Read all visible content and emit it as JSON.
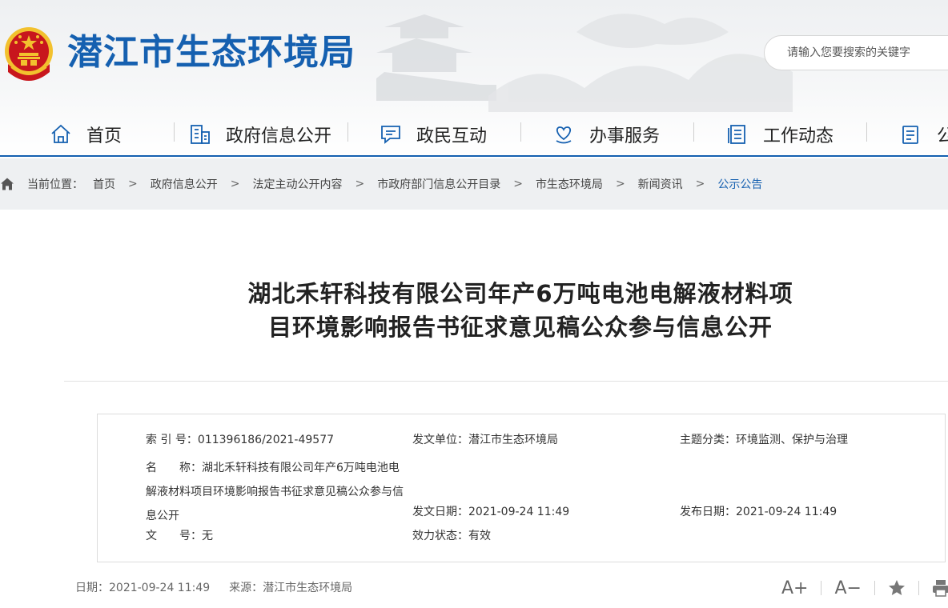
{
  "site": {
    "title": "潜江市生态环境局"
  },
  "search": {
    "placeholder": "请输入您要搜索的关键字"
  },
  "nav": {
    "items": [
      {
        "label": "首页",
        "icon": "home-icon"
      },
      {
        "label": "政府信息公开",
        "icon": "building-icon"
      },
      {
        "label": "政民互动",
        "icon": "chat-icon"
      },
      {
        "label": "办事服务",
        "icon": "heart-hand-icon"
      },
      {
        "label": "工作动态",
        "icon": "document-list-icon"
      },
      {
        "label": "公",
        "icon": "clipboard-icon"
      }
    ]
  },
  "breadcrumb": {
    "prefix": "当前位置：",
    "items": [
      "首页",
      "政府信息公开",
      "法定主动公开内容",
      "市政府部门信息公开目录",
      "市生态环境局",
      "新闻资讯",
      "公示公告"
    ],
    "separator": ">"
  },
  "article": {
    "title_line1": "湖北禾轩科技有限公司年产6万吨电池电解液材料项",
    "title_line2": "目环境影响报告书征求意见稿公众参与信息公开"
  },
  "meta": {
    "index_label": "索 引 号：",
    "index_value": "011396186/2021-49577",
    "issuer_label": "发文单位：",
    "issuer_value": "潜江市生态环境局",
    "topic_label": "主题分类：",
    "topic_value": "环境监测、保护与治理",
    "name_label": "名　　称：",
    "name_value": "湖北禾轩科技有限公司年产6万吨电池电解液材料项目环境影响报告书征求意见稿公众参与信息公开",
    "issue_date_label": "发文日期：",
    "issue_date_value": "2021-09-24 11:49",
    "publish_date_label": "发布日期：",
    "publish_date_value": "2021-09-24 11:49",
    "doc_no_label": "文　　号：",
    "doc_no_value": "无",
    "status_label": "效力状态：",
    "status_value": "有效"
  },
  "footer": {
    "date": "日期：2021-09-24 11:49",
    "source": "来源：潜江市生态环境局",
    "font_up": "A+",
    "font_down": "A−"
  },
  "colors": {
    "brand": "#1560b0",
    "emblem_red": "#c8161d",
    "emblem_gold": "#f2c12e"
  }
}
